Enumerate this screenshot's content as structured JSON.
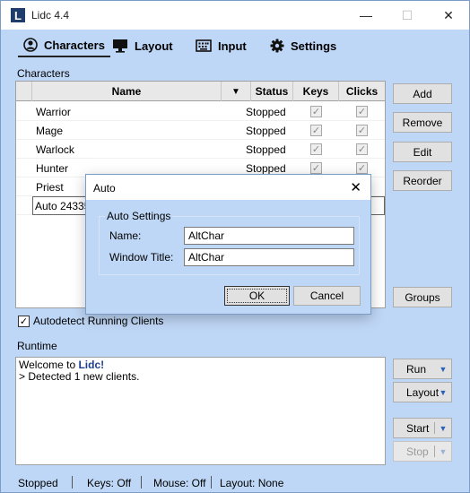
{
  "app": {
    "title": "Lidc 4.4",
    "logo_letter": "L"
  },
  "window_controls": {
    "minimize": "—",
    "maximize": "☐",
    "close": "✕"
  },
  "tabs": [
    {
      "label": "Characters",
      "icon": "user-icon"
    },
    {
      "label": "Layout",
      "icon": "monitor-icon"
    },
    {
      "label": "Input",
      "icon": "keyboard-icon"
    },
    {
      "label": "Settings",
      "icon": "gear-icon"
    }
  ],
  "characters": {
    "section_label": "Characters",
    "columns": {
      "name": "Name",
      "status": "Status",
      "keys": "Keys",
      "clicks": "Clicks"
    },
    "rows": [
      {
        "name": "Warrior",
        "status": "Stopped",
        "keys": true,
        "clicks": true
      },
      {
        "name": "Mage",
        "status": "Stopped",
        "keys": true,
        "clicks": true
      },
      {
        "name": "Warlock",
        "status": "Stopped",
        "keys": true,
        "clicks": true
      },
      {
        "name": "Hunter",
        "status": "Stopped",
        "keys": true,
        "clicks": true
      },
      {
        "name": "Priest",
        "status": "",
        "keys": false,
        "clicks": false
      }
    ],
    "editing_row_value": "Auto 24335",
    "buttons": {
      "add": "Add",
      "remove": "Remove",
      "edit": "Edit",
      "reorder": "Reorder",
      "groups": "Groups"
    },
    "autodetect_label": "Autodetect Running Clients",
    "autodetect_checked": true
  },
  "runtime": {
    "section_label": "Runtime",
    "log": {
      "welcome_prefix": "Welcome to ",
      "welcome_brand": "Lidc!",
      "line2": "> Detected 1 new clients."
    },
    "buttons": {
      "run": "Run",
      "layout": "Layout",
      "start": "Start",
      "stop": "Stop"
    }
  },
  "statusbar": {
    "state": "Stopped",
    "keys": "Keys: Off",
    "mouse": "Mouse: Off",
    "layout": "Layout: None"
  },
  "dialog": {
    "title": "Auto",
    "group_label": "Auto Settings",
    "name_label": "Name:",
    "name_value": "AltChar",
    "window_title_label": "Window Title:",
    "window_title_value": "AltChar",
    "ok": "OK",
    "cancel": "Cancel"
  },
  "colors": {
    "window_bg": "#bfd7f6",
    "brand": "#1f3d6b",
    "accent_arrow": "#2a62b8"
  }
}
